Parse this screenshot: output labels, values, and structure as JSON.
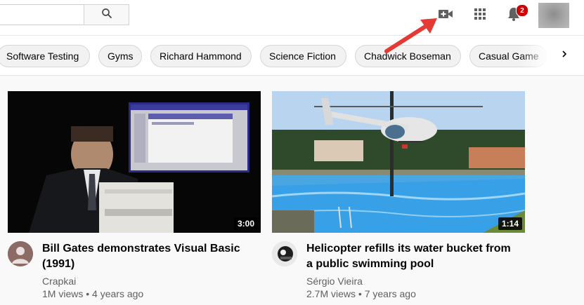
{
  "header": {
    "notification_count": "2"
  },
  "chips": [
    {
      "label": "Software Testing"
    },
    {
      "label": "Gyms"
    },
    {
      "label": "Richard Hammond"
    },
    {
      "label": "Science Fiction"
    },
    {
      "label": "Chadwick Boseman"
    },
    {
      "label": "Casual Game"
    }
  ],
  "videos": [
    {
      "duration": "3:00",
      "title": "Bill Gates demonstrates Visual Basic (1991)",
      "channel": "Crapkai",
      "views": "1M views",
      "age": "4 years ago"
    },
    {
      "duration": "1:14",
      "title": "Helicopter refills its water bucket from a public swimming pool",
      "channel": "Sérgio Vieira",
      "views": "2.7M views",
      "age": "7 years ago"
    }
  ],
  "meta_separator": "•",
  "colors": {
    "badge": "#cc0000",
    "annotation_arrow": "#e53935"
  }
}
